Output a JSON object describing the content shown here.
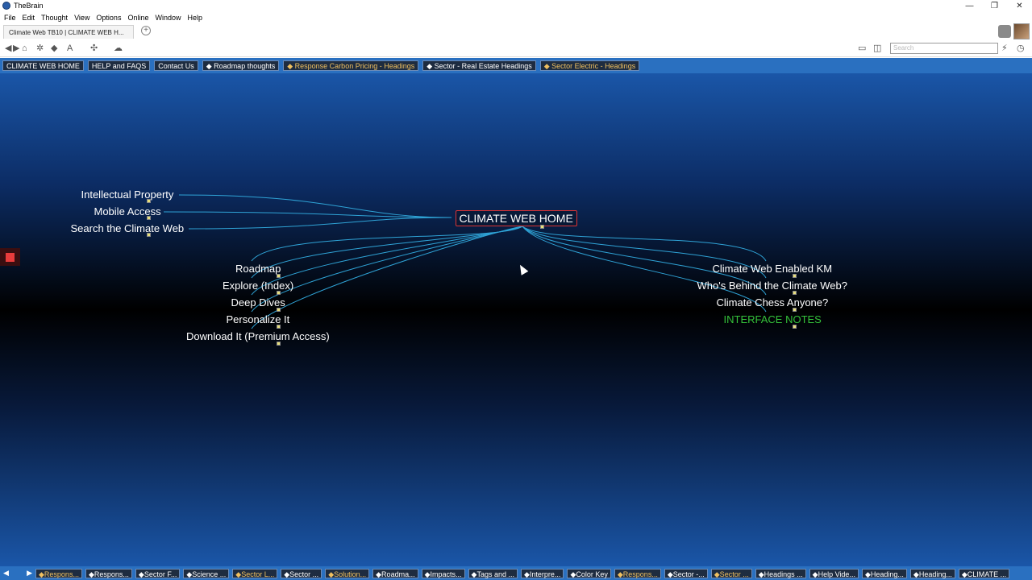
{
  "app": {
    "title": "TheBrain",
    "window_controls": [
      "—",
      "❐",
      "✕"
    ]
  },
  "menu": [
    "File",
    "Edit",
    "Thought",
    "View",
    "Options",
    "Online",
    "Window",
    "Help"
  ],
  "tab": {
    "label": "Climate Web TB10 | CLIMATE WEB H...",
    "add_label": "+"
  },
  "toolbar": {
    "search_placeholder": "Search"
  },
  "pins": [
    {
      "label": "CLIMATE WEB HOME",
      "tag": false,
      "orange": false
    },
    {
      "label": "HELP and FAQS",
      "tag": false,
      "orange": false
    },
    {
      "label": "Contact Us",
      "tag": false,
      "orange": false
    },
    {
      "label": "Roadmap thoughts",
      "tag": true,
      "orange": false
    },
    {
      "label": "Response Carbon Pricing - Headings",
      "tag": true,
      "orange": true
    },
    {
      "label": "Sector - Real Estate Headings",
      "tag": true,
      "orange": false
    },
    {
      "label": "Sector Electric - Headings",
      "tag": true,
      "orange": true
    }
  ],
  "plex": {
    "central": "CLIMATE WEB HOME",
    "parents": [
      "Intellectual Property",
      "Mobile Access",
      "Search the Climate Web"
    ],
    "children_left": [
      "Roadmap",
      "Explore (Index)",
      "Deep Dives",
      "Personalize It",
      "Download It (Premium Access)"
    ],
    "children_right": [
      "Climate Web Enabled KM",
      "Who's Behind the Climate Web?",
      "Climate Chess Anyone?",
      "INTERFACE NOTES"
    ],
    "colors": {
      "line": "#2fa3d6",
      "highlight": "#34c23a",
      "central_border": "#dd3333"
    }
  },
  "status_tabs": [
    {
      "label": "Respons...",
      "orange": true
    },
    {
      "label": "Respons...",
      "orange": false
    },
    {
      "label": "Sector F...",
      "orange": false
    },
    {
      "label": "Science ...",
      "orange": false
    },
    {
      "label": "Sector L...",
      "orange": true
    },
    {
      "label": "Sector ...",
      "orange": false
    },
    {
      "label": "Solution...",
      "orange": true
    },
    {
      "label": "Roadma...",
      "orange": false
    },
    {
      "label": "Impacts...",
      "orange": false
    },
    {
      "label": "Tags and ...",
      "orange": false
    },
    {
      "label": "Interpre...",
      "orange": false
    },
    {
      "label": "Color Key",
      "orange": false
    },
    {
      "label": "Respons...",
      "orange": true
    },
    {
      "label": "Sector -...",
      "orange": false
    },
    {
      "label": "Sector ...",
      "orange": true
    },
    {
      "label": "Headings ...",
      "orange": false
    },
    {
      "label": "Help Vide...",
      "orange": false
    },
    {
      "label": "Heading...",
      "orange": false
    },
    {
      "label": "Heading...",
      "orange": false
    },
    {
      "label": "CLIMATE ...",
      "orange": false
    }
  ]
}
